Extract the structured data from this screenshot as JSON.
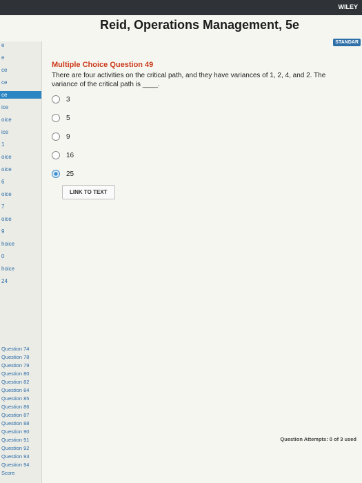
{
  "app": {
    "book_title": "Reid, Operations Management, 5e",
    "brand": "WILEY",
    "badge": "STANDAR"
  },
  "sidebar": {
    "items": [
      {
        "label": "e"
      },
      {
        "label": "e"
      },
      {
        "label": "ce"
      },
      {
        "label": "ce"
      },
      {
        "label": "ce"
      },
      {
        "label": "ice"
      },
      {
        "label": "oice"
      },
      {
        "label": "ice"
      },
      {
        "label": "1"
      },
      {
        "label": "oice"
      },
      {
        "label": "oice"
      },
      {
        "label": "6"
      },
      {
        "label": "oice"
      },
      {
        "label": "7"
      },
      {
        "label": "oice"
      },
      {
        "label": "9"
      },
      {
        "label": "hoice"
      },
      {
        "label": "0"
      },
      {
        "label": "hoice"
      },
      {
        "label": "24"
      }
    ],
    "questions": [
      {
        "label": "Question 74"
      },
      {
        "label": "Question 78"
      },
      {
        "label": "Question 79"
      },
      {
        "label": "Question 80"
      },
      {
        "label": "Question 82"
      },
      {
        "label": "Question 84"
      },
      {
        "label": "Question 85"
      },
      {
        "label": "Question 86"
      },
      {
        "label": "Question 87"
      },
      {
        "label": "Question 88"
      },
      {
        "label": "Question 90"
      },
      {
        "label": "Question 91"
      },
      {
        "label": "Question 92"
      },
      {
        "label": "Question 93"
      },
      {
        "label": "Question 94"
      },
      {
        "label": "Score"
      }
    ]
  },
  "question": {
    "header": "Multiple Choice Question 49",
    "text": "There are four activities on the critical path, and they have variances of 1, 2, 4, and 2. The variance of the critical path is ____.",
    "choices": [
      {
        "label": "3",
        "selected": false
      },
      {
        "label": "5",
        "selected": false
      },
      {
        "label": "9",
        "selected": false
      },
      {
        "label": "16",
        "selected": false
      },
      {
        "label": "25",
        "selected": true
      }
    ],
    "link_to_text": "LINK TO TEXT",
    "attempts": "Question Attempts: 0 of 3 used"
  }
}
